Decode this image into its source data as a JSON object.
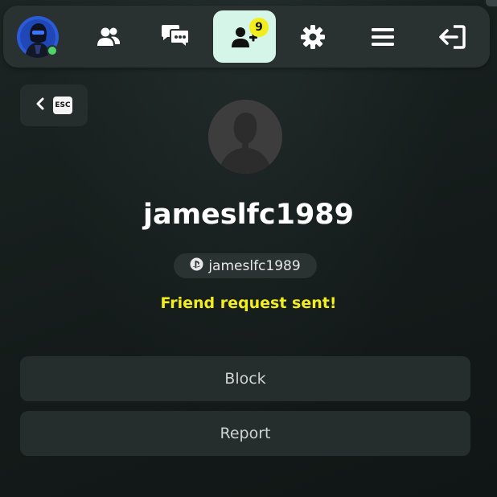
{
  "nav": {
    "items": [
      {
        "name": "avatar",
        "icon": "player-avatar"
      },
      {
        "name": "friends",
        "icon": "friends-icon"
      },
      {
        "name": "chat",
        "icon": "chat-icon"
      },
      {
        "name": "friend-requests",
        "icon": "add-friend-icon",
        "active": true,
        "badge": "9"
      },
      {
        "name": "settings",
        "icon": "gear-icon"
      },
      {
        "name": "menu",
        "icon": "menu-icon"
      },
      {
        "name": "exit",
        "icon": "exit-icon"
      }
    ],
    "badge_count": "9",
    "active_color": "#d6f5e9",
    "online_color": "#4fd36a"
  },
  "back": {
    "key_label": "ESC",
    "icon": "chevron-left-icon"
  },
  "profile": {
    "username": "jameslfc1989",
    "platform_icon": "playstation-icon",
    "platform_username": "jameslfc1989",
    "status": "Friend request sent!",
    "status_color": "#f2ee1c"
  },
  "actions": {
    "block_label": "Block",
    "report_label": "Report"
  }
}
